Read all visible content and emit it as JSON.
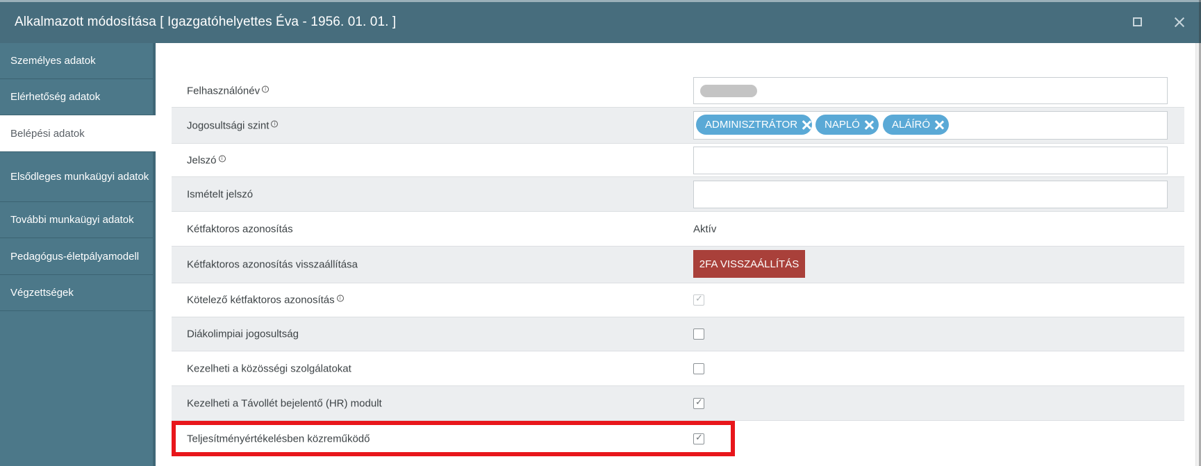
{
  "window": {
    "title": "Alkalmazott módosítása [ Igazgatóhelyettes Éva - 1956. 01. 01. ]"
  },
  "sidebar": {
    "items": [
      {
        "label": "Személyes adatok"
      },
      {
        "label": "Elérhetőség adatok"
      },
      {
        "label": "Belépési adatok",
        "active": true
      },
      {
        "label": "Elsődleges munkaügyi adatok"
      },
      {
        "label": "További munkaügyi adatok"
      },
      {
        "label": "Pedagógus-életpályamodell"
      },
      {
        "label": "Végzettségek"
      }
    ]
  },
  "form": {
    "username": {
      "label": "Felhasználónév",
      "value_redacted": true
    },
    "permission_level": {
      "label": "Jogosultsági szint",
      "tags": [
        "ADMINISZTRÁTOR",
        "NAPLÓ",
        "ALÁÍRÓ"
      ]
    },
    "password": {
      "label": "Jelszó",
      "value": ""
    },
    "password_repeat": {
      "label": "Ismételt jelszó",
      "value": ""
    },
    "two_factor": {
      "label": "Kétfaktoros azonosítás",
      "value": "Aktív"
    },
    "two_factor_reset": {
      "label": "Kétfaktoros azonosítás visszaállítása",
      "button_label": "2FA VISSZAÁLLÍTÁS"
    },
    "mandatory_two_factor": {
      "label": "Kötelező kétfaktoros azonosítás",
      "checked": true,
      "disabled": true
    },
    "student_olympics": {
      "label": "Diákolimpiai jogosultság",
      "checked": false
    },
    "community_service": {
      "label": "Kezelheti a közösségi szolgálatokat",
      "checked": false
    },
    "absence_module": {
      "label": "Kezelheti a Távollét bejelentő (HR) modult",
      "checked": true
    },
    "performance_evaluation": {
      "label": "Teljesítményértékelésben közreműködő",
      "checked": true
    }
  },
  "colors": {
    "titlebar": "#476d7d",
    "sidebar": "#4c7889",
    "tag": "#5aa9d6",
    "reset_button": "#a9403a",
    "highlight": "#e8161b"
  },
  "icons": {
    "info": "info-icon",
    "maximize": "maximize-icon",
    "close": "close-icon",
    "tag_remove": "close-icon"
  }
}
